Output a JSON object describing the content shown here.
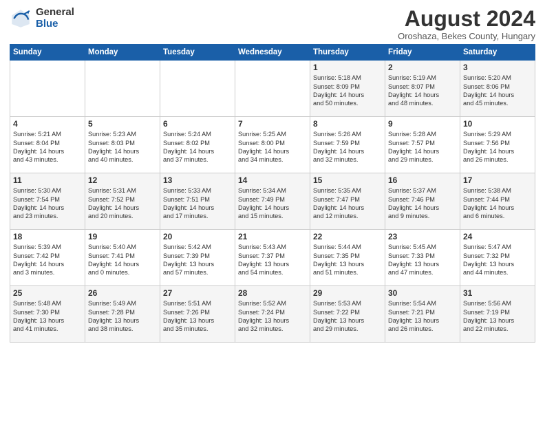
{
  "logo": {
    "general": "General",
    "blue": "Blue"
  },
  "title": "August 2024",
  "subtitle": "Oroshaza, Bekes County, Hungary",
  "days_header": [
    "Sunday",
    "Monday",
    "Tuesday",
    "Wednesday",
    "Thursday",
    "Friday",
    "Saturday"
  ],
  "weeks": [
    [
      {
        "day": "",
        "text": ""
      },
      {
        "day": "",
        "text": ""
      },
      {
        "day": "",
        "text": ""
      },
      {
        "day": "",
        "text": ""
      },
      {
        "day": "1",
        "text": "Sunrise: 5:18 AM\nSunset: 8:09 PM\nDaylight: 14 hours\nand 50 minutes."
      },
      {
        "day": "2",
        "text": "Sunrise: 5:19 AM\nSunset: 8:07 PM\nDaylight: 14 hours\nand 48 minutes."
      },
      {
        "day": "3",
        "text": "Sunrise: 5:20 AM\nSunset: 8:06 PM\nDaylight: 14 hours\nand 45 minutes."
      }
    ],
    [
      {
        "day": "4",
        "text": "Sunrise: 5:21 AM\nSunset: 8:04 PM\nDaylight: 14 hours\nand 43 minutes."
      },
      {
        "day": "5",
        "text": "Sunrise: 5:23 AM\nSunset: 8:03 PM\nDaylight: 14 hours\nand 40 minutes."
      },
      {
        "day": "6",
        "text": "Sunrise: 5:24 AM\nSunset: 8:02 PM\nDaylight: 14 hours\nand 37 minutes."
      },
      {
        "day": "7",
        "text": "Sunrise: 5:25 AM\nSunset: 8:00 PM\nDaylight: 14 hours\nand 34 minutes."
      },
      {
        "day": "8",
        "text": "Sunrise: 5:26 AM\nSunset: 7:59 PM\nDaylight: 14 hours\nand 32 minutes."
      },
      {
        "day": "9",
        "text": "Sunrise: 5:28 AM\nSunset: 7:57 PM\nDaylight: 14 hours\nand 29 minutes."
      },
      {
        "day": "10",
        "text": "Sunrise: 5:29 AM\nSunset: 7:56 PM\nDaylight: 14 hours\nand 26 minutes."
      }
    ],
    [
      {
        "day": "11",
        "text": "Sunrise: 5:30 AM\nSunset: 7:54 PM\nDaylight: 14 hours\nand 23 minutes."
      },
      {
        "day": "12",
        "text": "Sunrise: 5:31 AM\nSunset: 7:52 PM\nDaylight: 14 hours\nand 20 minutes."
      },
      {
        "day": "13",
        "text": "Sunrise: 5:33 AM\nSunset: 7:51 PM\nDaylight: 14 hours\nand 17 minutes."
      },
      {
        "day": "14",
        "text": "Sunrise: 5:34 AM\nSunset: 7:49 PM\nDaylight: 14 hours\nand 15 minutes."
      },
      {
        "day": "15",
        "text": "Sunrise: 5:35 AM\nSunset: 7:47 PM\nDaylight: 14 hours\nand 12 minutes."
      },
      {
        "day": "16",
        "text": "Sunrise: 5:37 AM\nSunset: 7:46 PM\nDaylight: 14 hours\nand 9 minutes."
      },
      {
        "day": "17",
        "text": "Sunrise: 5:38 AM\nSunset: 7:44 PM\nDaylight: 14 hours\nand 6 minutes."
      }
    ],
    [
      {
        "day": "18",
        "text": "Sunrise: 5:39 AM\nSunset: 7:42 PM\nDaylight: 14 hours\nand 3 minutes."
      },
      {
        "day": "19",
        "text": "Sunrise: 5:40 AM\nSunset: 7:41 PM\nDaylight: 14 hours\nand 0 minutes."
      },
      {
        "day": "20",
        "text": "Sunrise: 5:42 AM\nSunset: 7:39 PM\nDaylight: 13 hours\nand 57 minutes."
      },
      {
        "day": "21",
        "text": "Sunrise: 5:43 AM\nSunset: 7:37 PM\nDaylight: 13 hours\nand 54 minutes."
      },
      {
        "day": "22",
        "text": "Sunrise: 5:44 AM\nSunset: 7:35 PM\nDaylight: 13 hours\nand 51 minutes."
      },
      {
        "day": "23",
        "text": "Sunrise: 5:45 AM\nSunset: 7:33 PM\nDaylight: 13 hours\nand 47 minutes."
      },
      {
        "day": "24",
        "text": "Sunrise: 5:47 AM\nSunset: 7:32 PM\nDaylight: 13 hours\nand 44 minutes."
      }
    ],
    [
      {
        "day": "25",
        "text": "Sunrise: 5:48 AM\nSunset: 7:30 PM\nDaylight: 13 hours\nand 41 minutes."
      },
      {
        "day": "26",
        "text": "Sunrise: 5:49 AM\nSunset: 7:28 PM\nDaylight: 13 hours\nand 38 minutes."
      },
      {
        "day": "27",
        "text": "Sunrise: 5:51 AM\nSunset: 7:26 PM\nDaylight: 13 hours\nand 35 minutes."
      },
      {
        "day": "28",
        "text": "Sunrise: 5:52 AM\nSunset: 7:24 PM\nDaylight: 13 hours\nand 32 minutes."
      },
      {
        "day": "29",
        "text": "Sunrise: 5:53 AM\nSunset: 7:22 PM\nDaylight: 13 hours\nand 29 minutes."
      },
      {
        "day": "30",
        "text": "Sunrise: 5:54 AM\nSunset: 7:21 PM\nDaylight: 13 hours\nand 26 minutes."
      },
      {
        "day": "31",
        "text": "Sunrise: 5:56 AM\nSunset: 7:19 PM\nDaylight: 13 hours\nand 22 minutes."
      }
    ]
  ]
}
